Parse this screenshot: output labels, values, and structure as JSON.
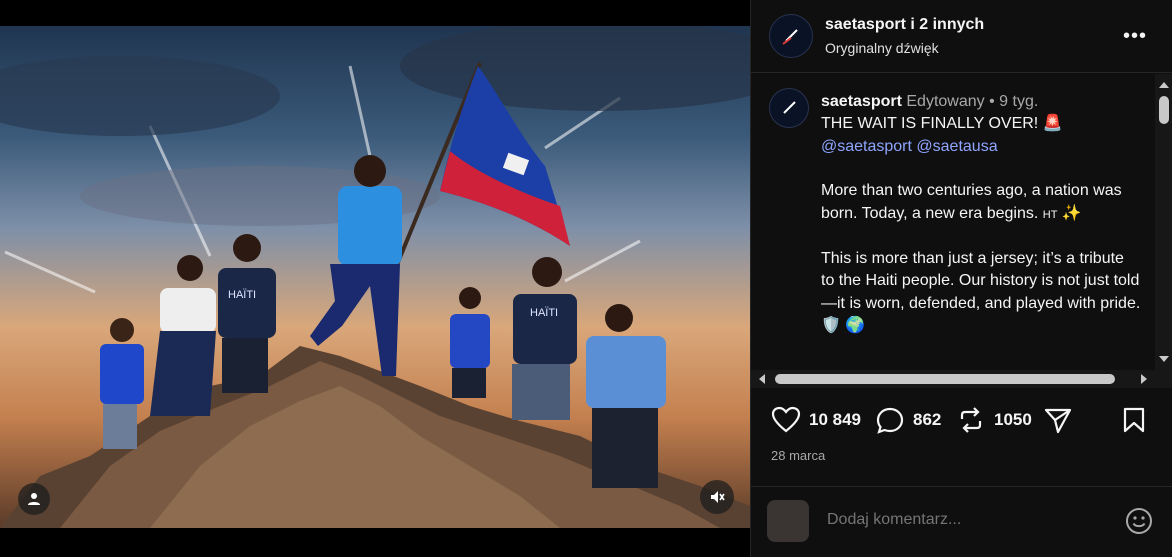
{
  "post": {
    "header_title": "saetasport i 2 innych",
    "header_subtitle": "Oryginalny dźwięk",
    "more_label": "•••"
  },
  "caption": {
    "username": "saetasport",
    "edited_label": "Edytowany",
    "separator": "•",
    "age": "9 tyg.",
    "headline": "THE WAIT IS FINALLY OVER!",
    "headline_emoji": "🚨",
    "mention1": "@saetasport",
    "mention2": "@saetausa",
    "para1": "More than two centuries ago, a nation was born. Today, a new era begins.",
    "para1_flag": "HT",
    "para1_emoji": "✨",
    "para2": "This is more than just a jersey; it’s a tribute to the Haiti people. Our history is not just told—it is worn, defended, and played with pride.",
    "para2_emoji1": "🛡️",
    "para2_emoji2": "🌍"
  },
  "actions": {
    "likes": "10 849",
    "comments": "862",
    "reposts": "1050"
  },
  "date": "28 marca",
  "comment": {
    "placeholder": "Dodaj komentarz..."
  },
  "colors": {
    "accent_mention": "#8fa5ff",
    "panel_bg": "#0f0f0f",
    "flag_blue": "#1b3fa6",
    "flag_red": "#d0213a"
  },
  "icons": {
    "like": "heart-icon",
    "comment": "comment-icon",
    "repost": "repost-icon",
    "share": "send-icon",
    "save": "bookmark-icon",
    "emoji": "emoji-icon",
    "mute": "mute-icon",
    "tag": "user-tag-icon"
  }
}
